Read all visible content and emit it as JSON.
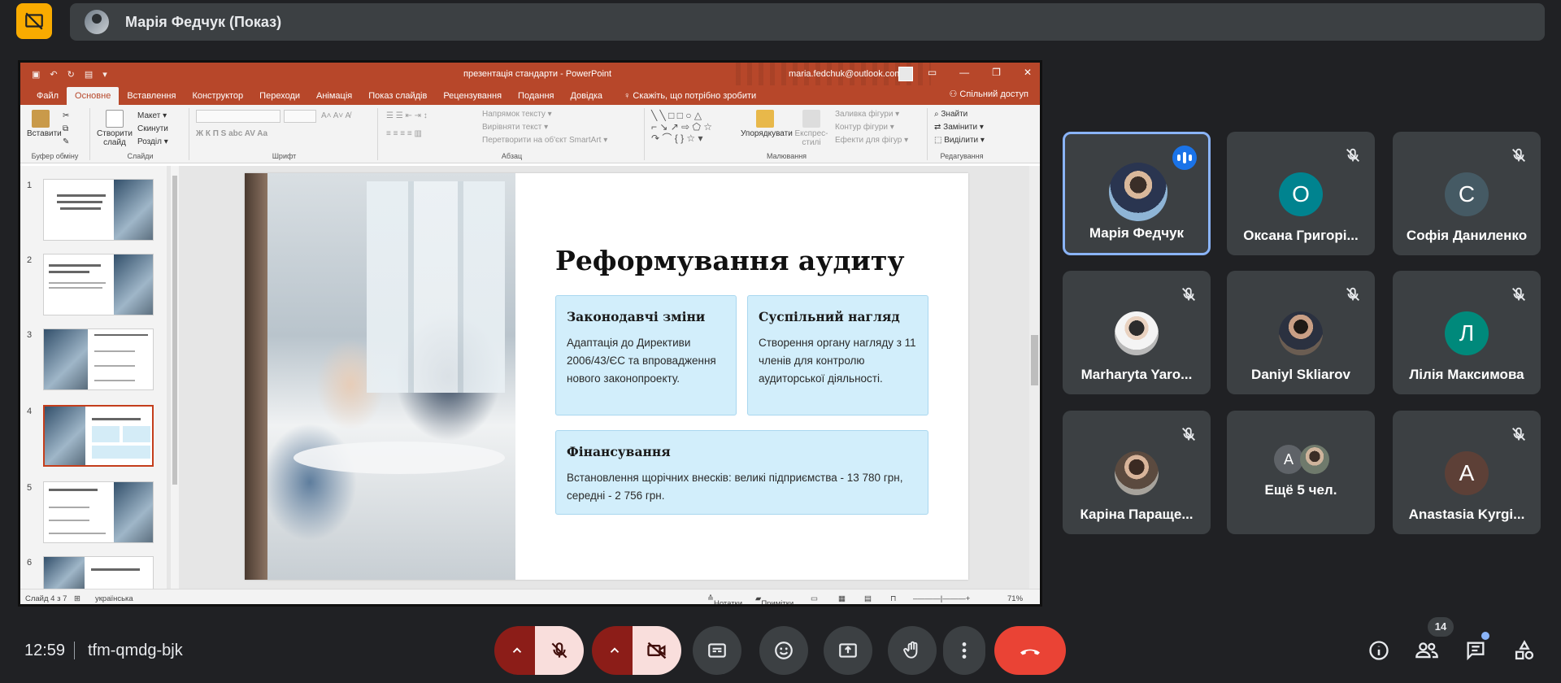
{
  "top": {
    "presenter": "Марія Федчук (Показ)"
  },
  "ppt": {
    "doc_title": "презентація стандарти  -  PowerPoint",
    "email": "maria.fedchuk@outlook.com",
    "tabs": [
      "Файл",
      "Основне",
      "Вставлення",
      "Конструктор",
      "Переходи",
      "Анімація",
      "Показ слайдів",
      "Рецензування",
      "Подання",
      "Довідка"
    ],
    "tell_me": "Скажіть, що потрібно зробити",
    "share": "Спільний доступ",
    "ribbon": {
      "paste": "Вставити",
      "clipboard": "Буфер обміну",
      "new_slide": "Створити слайд",
      "layout": "Макет",
      "reset": "Скинути",
      "section": "Розділ",
      "slides": "Слайди",
      "font": "Шрифт",
      "paragraph": "Абзац",
      "text_direction": "Напрямок тексту",
      "align_text": "Вирівняти текст",
      "smartart": "Перетворити на об'єкт SmartArt",
      "arrange": "Упорядкувати",
      "quick_styles": "Експрес-стилі",
      "shape_fill": "Заливка фігури",
      "shape_outline": "Контур фігури",
      "shape_effects": "Ефекти для фігур",
      "drawing": "Малювання",
      "find": "Знайти",
      "replace": "Замінити",
      "select": "Виділити",
      "editing": "Редагування"
    },
    "thumb_numbers": [
      "1",
      "2",
      "3",
      "4",
      "5",
      "6"
    ],
    "slide": {
      "title": "Реформування аудиту",
      "card1_title": "Законодавчі зміни",
      "card1_text": "Адаптація до Директиви 2006/43/ЄС та впровадження нового законопроекту.",
      "card2_title": "Суспільний нагляд",
      "card2_text": "Створення органу нагляду з 11 членів для контролю аудиторської діяльності.",
      "card3_title": "Фінансування",
      "card3_text": "Встановлення щорічних внесків: великі підприємства - 13 780 грн, середні - 2 756 грн."
    },
    "status": {
      "slide_of": "Слайд 4 з 7",
      "language": "українська",
      "notes": "Нотатки",
      "comments": "Примітки",
      "zoom": "71%"
    }
  },
  "participants": [
    {
      "name": "Марія Федчук",
      "state": "speaking"
    },
    {
      "name": "Оксана Григорі...",
      "letter": "О",
      "color": "#00838f"
    },
    {
      "name": "Софія Даниленко",
      "letter": "С",
      "color": "#455a64"
    },
    {
      "name": "Marharyta Yaro...",
      "state": "muted"
    },
    {
      "name": "Daniyl Skliarov",
      "state": "muted"
    },
    {
      "name": "Лілія Максимова",
      "letter": "Л",
      "color": "#00897b"
    },
    {
      "name": "Каріна Параще...",
      "state": "muted"
    },
    {
      "name": "Ещё 5 чел.",
      "letter": "А"
    },
    {
      "name": "Anastasia Kyrgi...",
      "letter": "A",
      "color": "#5d4037"
    }
  ],
  "bottom": {
    "time": "12:59",
    "meeting_code": "tfm-qmdg-bjk",
    "people_count": "14"
  }
}
